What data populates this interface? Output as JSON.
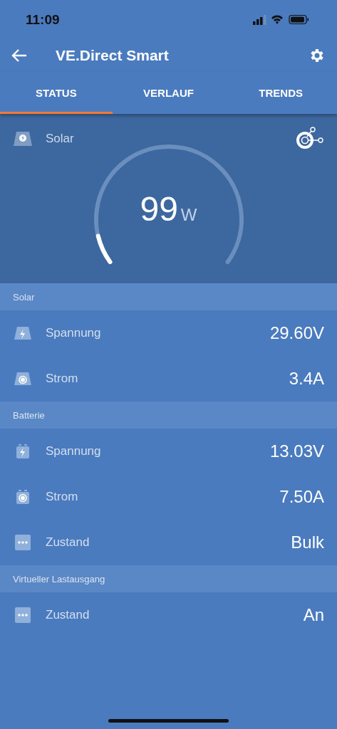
{
  "status_bar": {
    "time": "11:09"
  },
  "app_bar": {
    "title": "VE.Direct Smart"
  },
  "tabs": [
    {
      "label": "STATUS",
      "selected": true
    },
    {
      "label": "VERLAUF",
      "selected": false
    },
    {
      "label": "TRENDS",
      "selected": false
    }
  ],
  "hero": {
    "label": "Solar",
    "value": "99",
    "unit": "W"
  },
  "sections": [
    {
      "title": "Solar",
      "rows": [
        {
          "kind": "panel-bolt",
          "label": "Spannung",
          "value": "29.60V"
        },
        {
          "kind": "panel-dot",
          "label": "Strom",
          "value": "3.4A"
        }
      ]
    },
    {
      "title": "Batterie",
      "rows": [
        {
          "kind": "battery-bolt",
          "label": "Spannung",
          "value": "13.03V"
        },
        {
          "kind": "battery-dot",
          "label": "Strom",
          "value": "7.50A"
        },
        {
          "kind": "dots",
          "label": "Zustand",
          "value": "Bulk"
        }
      ]
    },
    {
      "title": "Virtueller Lastausgang",
      "rows": [
        {
          "kind": "dots",
          "label": "Zustand",
          "value": "An"
        }
      ]
    }
  ]
}
